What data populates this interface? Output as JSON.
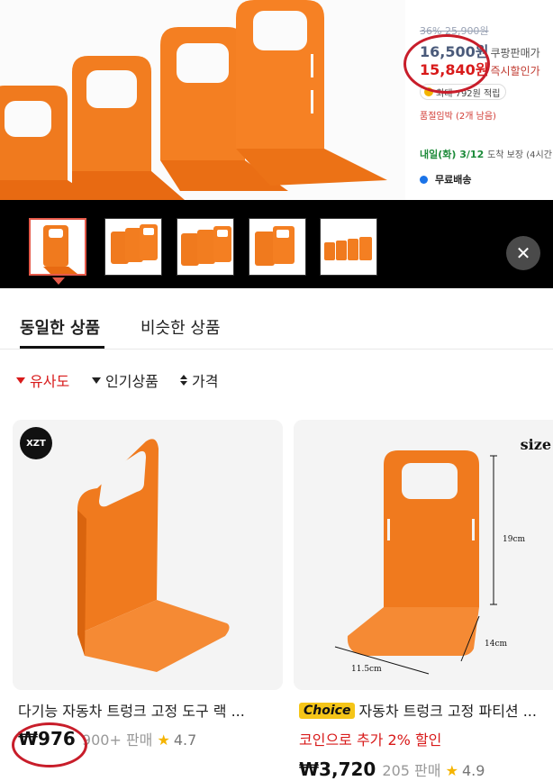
{
  "product_detail": {
    "original_price": "36% 25,900원",
    "coupang_price": "16,500원",
    "coupang_price_tag": "쿠팡판매가",
    "sale_price": "15,840원",
    "sale_price_tag": "즉시할인가",
    "reward_text": "최대 792원 적립",
    "stock_warning": "품절임박 (2개 남음)",
    "delivery_date": "내일(화) 3/12",
    "delivery_note": "도착 보장 (4시간 8",
    "shipping": "무료배송"
  },
  "thumbnails": {
    "count": 5,
    "active_index": 0,
    "close_label": "✕"
  },
  "sheet": {
    "tabs": [
      {
        "label": "동일한 상품",
        "active": true
      },
      {
        "label": "비슷한 상품",
        "active": false
      }
    ],
    "filters": [
      {
        "label": "유사도",
        "active": true
      },
      {
        "label": "인기상품",
        "active": false
      },
      {
        "label": "가격",
        "active": false
      }
    ],
    "products": [
      {
        "title": "다기능 자동차 트렁크 고정 도구 랙 ...",
        "price": "₩976",
        "sold": "900+ 판매",
        "rating": "4.7",
        "brand_logo": "XZT"
      },
      {
        "badge": "Choice",
        "title": "자동차 트렁크 고정 파티션 ...",
        "promo": "코인으로 추가 2% 할인",
        "price": "₩3,720",
        "sold": "205 판매",
        "rating": "4.9",
        "size_label": "size",
        "dim_height": "19cm",
        "dim_depth": "14cm",
        "dim_width": "11.5cm"
      }
    ]
  },
  "colors": {
    "accent_red": "#d81a1a",
    "product_orange": "#f07a1e",
    "annotation_circle": "#c81d2a",
    "rating_star": "#f5b400"
  }
}
